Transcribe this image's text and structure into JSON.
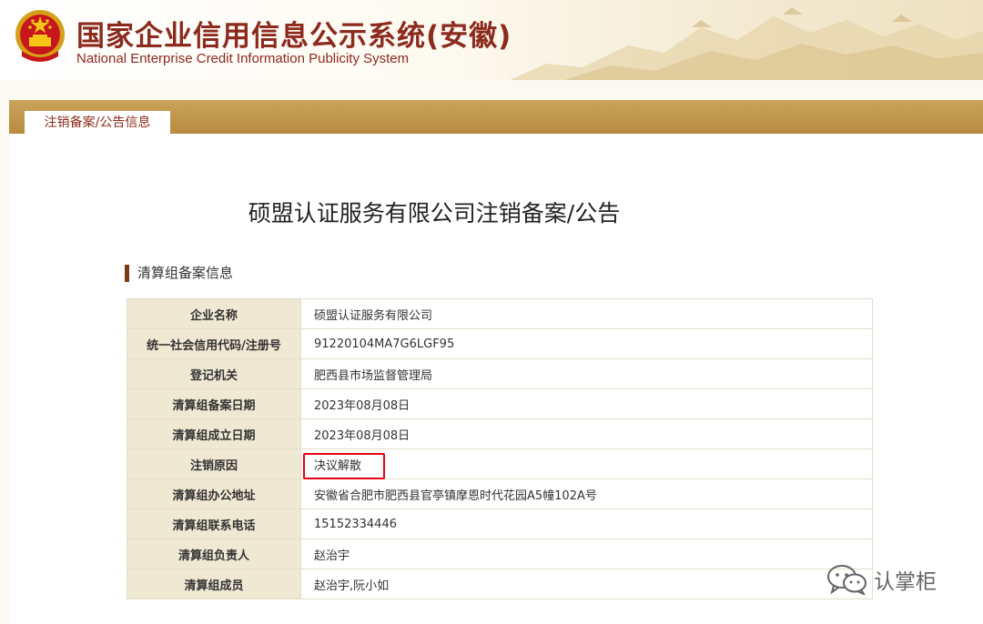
{
  "header": {
    "title": "国家企业信用信息公示系统(安徽)",
    "subtitle": "National Enterprise Credit Information Publicity System"
  },
  "tab": {
    "label": "注销备案/公告信息"
  },
  "page": {
    "title": "硕盟认证服务有限公司注销备案/公告"
  },
  "section": {
    "title": "清算组备案信息"
  },
  "table": {
    "rows": [
      {
        "label": "企业名称",
        "value": "硕盟认证服务有限公司"
      },
      {
        "label": "统一社会信用代码/注册号",
        "value": "91220104MA7G6LGF95"
      },
      {
        "label": "登记机关",
        "value": "肥西县市场监督管理局"
      },
      {
        "label": "清算组备案日期",
        "value": "2023年08月08日"
      },
      {
        "label": "清算组成立日期",
        "value": "2023年08月08日"
      },
      {
        "label": "注销原因",
        "value": "决议解散"
      },
      {
        "label": "清算组办公地址",
        "value": "安徽省合肥市肥西县官亭镇摩恩时代花园A5幢102A号"
      },
      {
        "label": "清算组联系电话",
        "value": "15152334446"
      },
      {
        "label": "清算组负责人",
        "value": "赵治宇"
      },
      {
        "label": "清算组成员",
        "value": "赵治宇,阮小如"
      }
    ]
  },
  "watermark": {
    "text": "认掌柜",
    "icon": "wechat-icon"
  },
  "colors": {
    "brand": "#8c2a1d",
    "tab_bar": "#b88b40",
    "label_cell_bg": "#efe8d3",
    "highlight": "#e60012"
  }
}
